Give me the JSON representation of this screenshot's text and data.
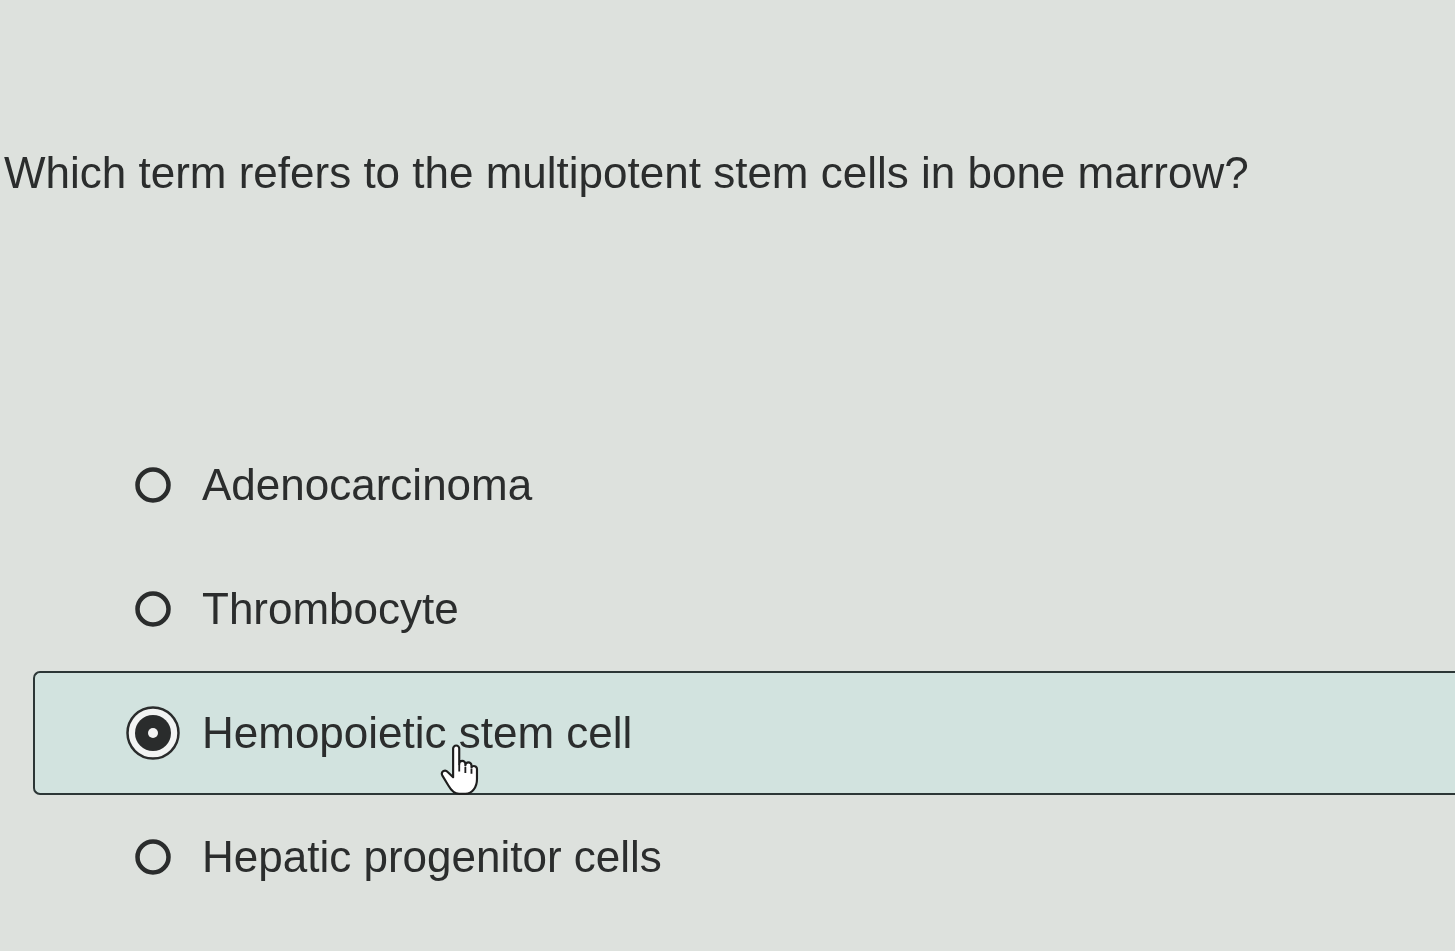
{
  "question": {
    "text": "Which term refers to the multipotent stem cells in bone marrow?"
  },
  "options": [
    {
      "label": "Adenocarcinoma",
      "selected": false
    },
    {
      "label": "Thrombocyte",
      "selected": false
    },
    {
      "label": "Hemopoietic stem cell",
      "selected": true
    },
    {
      "label": "Hepatic progenitor cells",
      "selected": false
    }
  ]
}
